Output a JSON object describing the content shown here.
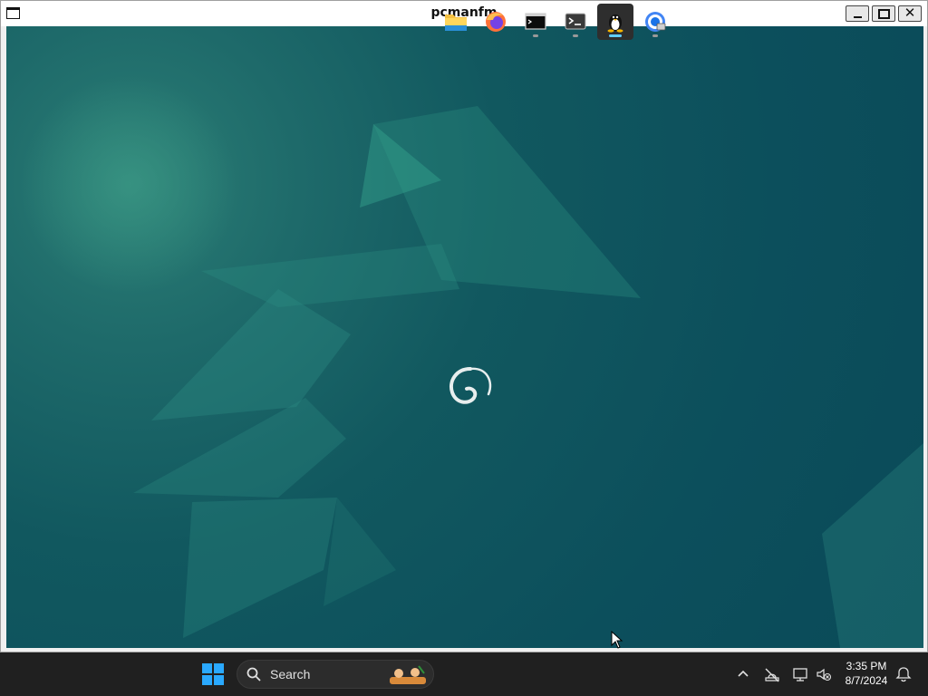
{
  "window": {
    "title": "pcmanfm",
    "minimize_label": "",
    "maximize_label": "",
    "close_label": "✕"
  },
  "desktop": {
    "wallpaper": "debian-emerald",
    "center_logo": "debian-swirl-icon"
  },
  "taskbar": {
    "start_icon": "windows-start-icon",
    "search": {
      "placeholder": "Search"
    },
    "apps": [
      {
        "name": "file-explorer",
        "icon": "folder-icon",
        "active": false
      },
      {
        "name": "firefox",
        "icon": "firefox-icon",
        "active": false
      },
      {
        "name": "terminal-1",
        "icon": "terminal-icon",
        "active": false,
        "running": true
      },
      {
        "name": "terminal-2",
        "icon": "powershell-icon",
        "active": false,
        "running": true
      },
      {
        "name": "linux",
        "icon": "tux-icon",
        "active": true,
        "running": true
      },
      {
        "name": "chrome-remote",
        "icon": "chrome-icon",
        "active": false,
        "running": true
      }
    ],
    "tray": {
      "time": "3:35 PM",
      "date": "8/7/2024",
      "icons": [
        "chevron-up-icon",
        "network-off-icon",
        "display-icon",
        "volume-muted-icon",
        "notification-bell-icon"
      ]
    }
  },
  "colors": {
    "accent": "#60cdff",
    "taskbar": "#202020",
    "wallpaper_base": "#0c4f5c"
  }
}
